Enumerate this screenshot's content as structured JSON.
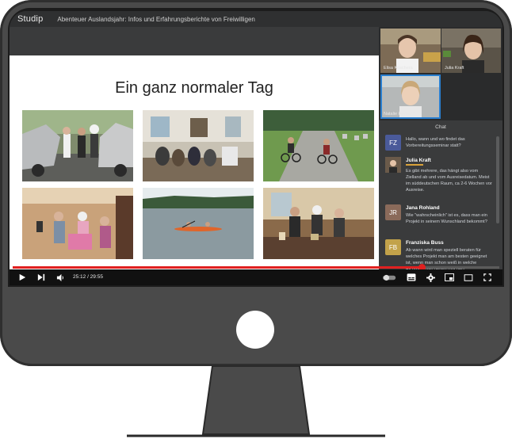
{
  "app": {
    "brand": "Studip",
    "title": "Abenteuer Auslandsjahr: Infos und Erfahrungsberichte von Freiwilligen"
  },
  "slide": {
    "title": "Ein ganz normaler Tag",
    "photos": [
      "car-repair-photo",
      "living-room-photo",
      "bike-path-photo",
      "gift-party-photo",
      "kayak-lake-photo",
      "kitchen-family-photo"
    ]
  },
  "participants": [
    {
      "name": "Elisa Koschera",
      "bg": "#8c7a66"
    },
    {
      "name": "Julia Kraft",
      "bg": "#6c6355"
    },
    {
      "name": "Natalie Homann",
      "bg": "#a5a8a8"
    }
  ],
  "chat": {
    "header": "Chat",
    "messages": [
      {
        "initials": "FZ",
        "name": "",
        "avatar_color": "#4a5a9a",
        "text": "Hallo, wann und wo findet das Vorbereitungsseminar statt?"
      },
      {
        "initials": "",
        "name": "Julia Kraft",
        "avatar_color": "#8b6a4a",
        "tag": "moderator",
        "text": "Es gibt mehrere, das hängt also vom Zielland ab und vom Ausreisedatum. Meist im süddeutschen Raum, ca 2-6 Wochen vor Ausreise."
      },
      {
        "initials": "JR",
        "name": "Jana Rohland",
        "avatar_color": "#8a6a5a",
        "text": "Wie \"wahrscheinlich\" ist es, dass man ein Projekt in seinem Wunschland bekommt?"
      },
      {
        "initials": "FB",
        "name": "Franziska Buss",
        "avatar_color": "#c2a24a",
        "text": "Ab wann wird man speziell beraten für welches Projekt man am besten geeignet ist, wenn man schon weiß in welche Richtung man gehen möchte?"
      }
    ]
  },
  "player": {
    "time": "25:12 / 29:55",
    "progress": 0.842,
    "accent": "#e02020"
  },
  "icons": [
    "play-icon",
    "next-icon",
    "volume-icon",
    "autoplay-toggle",
    "subtitles-icon",
    "settings-gear-icon",
    "miniplayer-icon",
    "theater-icon",
    "fullscreen-icon"
  ]
}
